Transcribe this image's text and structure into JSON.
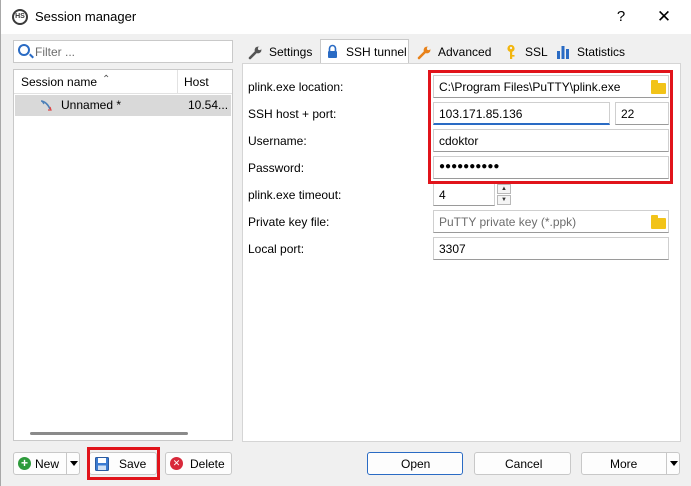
{
  "window": {
    "title": "Session manager",
    "help_label": "?",
    "close_label": "✕"
  },
  "sidebar": {
    "filter_placeholder": "Filter ...",
    "columns": [
      "Session name",
      "Host"
    ],
    "sessions": [
      {
        "name": "Unnamed *",
        "host": "10.54..."
      }
    ]
  },
  "tabs": [
    {
      "label": "Settings",
      "icon": "wrench-icon"
    },
    {
      "label": "SSH tunnel",
      "icon": "lock-icon",
      "active": true
    },
    {
      "label": "Advanced",
      "icon": "wrench-icon"
    },
    {
      "label": "SSL",
      "icon": "key-icon"
    },
    {
      "label": "Statistics",
      "icon": "bar-chart-icon"
    }
  ],
  "form": {
    "plink_location": {
      "label": "plink.exe location:",
      "value": "C:\\Program Files\\PuTTY\\plink.exe"
    },
    "ssh_host_port": {
      "label": "SSH host + port:",
      "host": "103.171.85.136",
      "port": "22"
    },
    "username": {
      "label": "Username:",
      "value": "cdoktor"
    },
    "password": {
      "label": "Password:",
      "value": "●●●●●●●●●●"
    },
    "plink_timeout": {
      "label": "plink.exe timeout:",
      "value": "4"
    },
    "private_key": {
      "label": "Private key file:",
      "placeholder": "PuTTY private key (*.ppk)"
    },
    "local_port": {
      "label": "Local port:",
      "value": "3307"
    }
  },
  "buttons": {
    "new": "New",
    "save": "Save",
    "delete": "Delete",
    "open": "Open",
    "cancel": "Cancel",
    "more": "More"
  },
  "colors": {
    "highlight_red": "#e1141b",
    "accent_blue": "#2a6bc4",
    "folder_yellow": "#f2c318"
  }
}
